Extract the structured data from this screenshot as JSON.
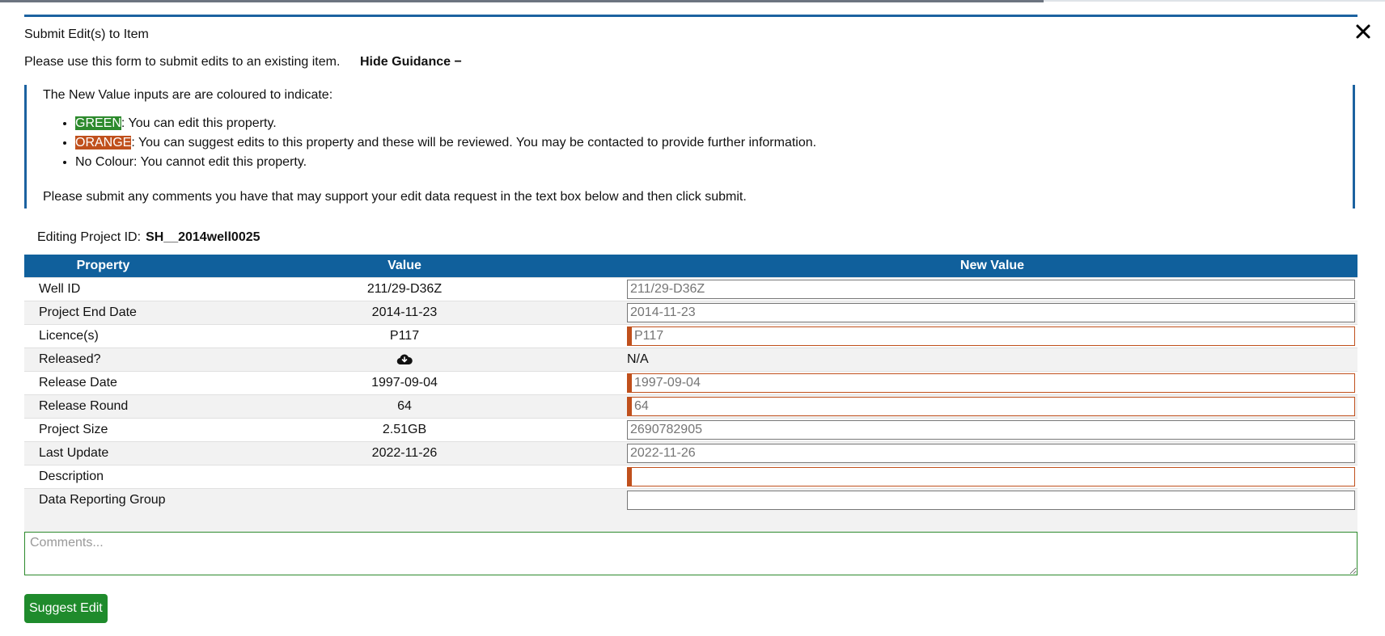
{
  "dialog": {
    "title": "Submit Edit(s) to Item",
    "intro": "Please use this form to submit edits to an existing item.",
    "hide_guidance": "Hide Guidance −"
  },
  "guidance": {
    "heading": "The New Value inputs are are coloured to indicate:",
    "items": [
      {
        "swatch": "GREEN",
        "text": ": You can edit this property."
      },
      {
        "swatch": "ORANGE",
        "text": ": You can suggest edits to this property and these will be reviewed. You may be contacted to provide further information."
      },
      {
        "swatch": "",
        "text": "No Colour: You cannot edit this property."
      }
    ],
    "footer": "Please submit any comments you have that may support your edit data request in the text box below and then click submit."
  },
  "editing": {
    "label": "Editing Project ID:",
    "project_id": "SH__2014well0025"
  },
  "table": {
    "headers": {
      "property": "Property",
      "value": "Value",
      "new_value": "New Value"
    },
    "rows": [
      {
        "property": "Well ID",
        "value": "211/29-D36Z",
        "new_value": "211/29-D36Z",
        "mode": "plain"
      },
      {
        "property": "Project End Date",
        "value": "2014-11-23",
        "new_value": "2014-11-23",
        "mode": "plain"
      },
      {
        "property": "Licence(s)",
        "value": "P117",
        "new_value": "P117",
        "mode": "orange"
      },
      {
        "property": "Released?",
        "value": "",
        "value_icon": "cloud-download-icon",
        "new_value": "N/A",
        "mode": "text"
      },
      {
        "property": "Release Date",
        "value": "1997-09-04",
        "new_value": "1997-09-04",
        "mode": "orange"
      },
      {
        "property": "Release Round",
        "value": "64",
        "new_value": "64",
        "mode": "orange"
      },
      {
        "property": "Project Size",
        "value": "2.51GB",
        "new_value": "2690782905",
        "mode": "plain"
      },
      {
        "property": "Last Update",
        "value": "2022-11-26",
        "new_value": "2022-11-26",
        "mode": "plain"
      },
      {
        "property": "Description",
        "value": "",
        "new_value": "",
        "mode": "orange"
      },
      {
        "property": "Data Reporting Group",
        "value": "",
        "new_value": "",
        "mode": "plain"
      }
    ]
  },
  "comments": {
    "placeholder": "Comments..."
  },
  "submit_label": "Suggest Edit",
  "colors": {
    "header_blue": "#10609c",
    "green": "#2c8a2c",
    "orange": "#c0501c"
  }
}
